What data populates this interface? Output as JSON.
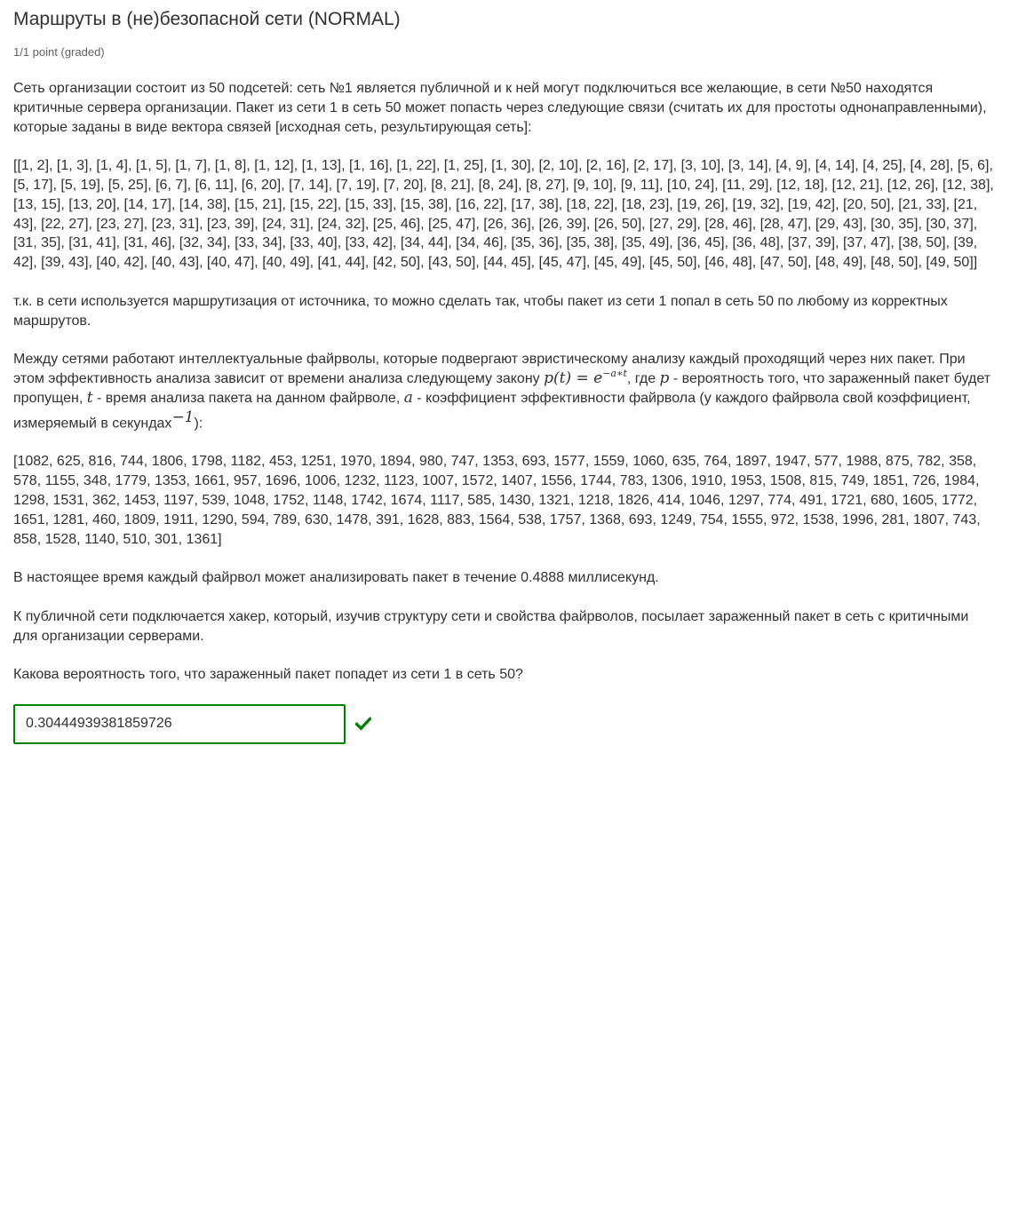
{
  "problem": {
    "title": "Маршруты в (не)безопасной сети (NORMAL)",
    "progress": "1/1 point (graded)",
    "paragraphs": {
      "intro": "Сеть организации состоит из 50 подсетей: сеть №1 является публичной и к ней могут подключиться все желающие, в сети №50 находятся критичные сервера организации. Пакет из сети 1 в сеть 50 может попасть через следующие связи (считать их для простоты однонаправленными), которые заданы в виде вектора связей [исходная сеть, результирующая сеть]:",
      "links": "[[1, 2], [1, 3], [1, 4], [1, 5], [1, 7], [1, 8], [1, 12], [1, 13], [1, 16], [1, 22], [1, 25], [1, 30], [2, 10], [2, 16], [2, 17], [3, 10], [3, 14], [4, 9], [4, 14], [4, 25], [4, 28], [5, 6], [5, 17], [5, 19], [5, 25], [6, 7], [6, 11], [6, 20], [7, 14], [7, 19], [7, 20], [8, 21], [8, 24], [8, 27], [9, 10], [9, 11], [10, 24], [11, 29], [12, 18], [12, 21], [12, 26], [12, 38], [13, 15], [13, 20], [14, 17], [14, 38], [15, 21], [15, 22], [15, 33], [15, 38], [16, 22], [17, 38], [18, 22], [18, 23], [19, 26], [19, 32], [19, 42], [20, 50], [21, 33], [21, 43], [22, 27], [23, 27], [23, 31], [23, 39], [24, 31], [24, 32], [25, 46], [25, 47], [26, 36], [26, 39], [26, 50], [27, 29], [28, 46], [28, 47], [29, 43], [30, 35], [30, 37], [31, 35], [31, 41], [31, 46], [32, 34], [33, 34], [33, 40], [33, 42], [34, 44], [34, 46], [35, 36], [35, 38], [35, 49], [36, 45], [36, 48], [37, 39], [37, 47], [38, 50], [39, 42], [39, 43], [40, 42], [40, 43], [40, 47], [40, 49], [41, 44], [42, 50], [43, 50], [44, 45], [45, 47], [45, 49], [45, 50], [46, 48], [47, 50], [48, 49], [48, 50], [49, 50]]",
      "routing": "т.к. в сети используется маршрутизация от источника, то можно сделать так, чтобы пакет из сети 1 попал в сеть 50 по любому из корректных маршрутов.",
      "firewall_a": "Между сетями работают интеллектуальные файрволы, которые подвергают эвристическому анализу каждый проходящий через них пакет. При этом эффективность анализа зависит от времени анализа следующему закону ",
      "formula_lhs": "p(t) = e",
      "formula_exp": "−a∗t",
      "firewall_b": ", где ",
      "var_p": "p",
      "firewall_c": " - вероятность того, что зараженный пакет будет пропущен, ",
      "var_t": "t",
      "firewall_d": " - время анализа пакета на данном файрволе, ",
      "var_a": "a",
      "firewall_e": " - коэффициент эффективности файрвола (у каждого файрвола свой коэффициент, измеряемый в секундах",
      "unit_exp": "−1",
      "firewall_f": "):",
      "coefficients": "[1082, 625, 816, 744, 1806, 1798, 1182, 453, 1251, 1970, 1894, 980, 747, 1353, 693, 1577, 1559, 1060, 635, 764, 1897, 1947, 577, 1988, 875, 782, 358, 578, 1155, 348, 1779, 1353, 1661, 957, 1696, 1006, 1232, 1123, 1007, 1572, 1407, 1556, 1744, 783, 1306, 1910, 1953, 1508, 815, 749, 1851, 726, 1984, 1298, 1531, 362, 1453, 1197, 539, 1048, 1752, 1148, 1742, 1674, 1117, 585, 1430, 1321, 1218, 1826, 414, 1046, 1297, 774, 491, 1721, 680, 1605, 1772, 1651, 1281, 460, 1809, 1911, 1290, 594, 789, 630, 1478, 391, 1628, 883, 1564, 538, 1757, 1368, 693, 1249, 754, 1555, 972, 1538, 1996, 281, 1807, 743, 858, 1528, 1140, 510, 301, 1361]",
      "analysis_time": "В настоящее время каждый файрвол может анализировать пакет в течение 0.4888 миллисекунд.",
      "hacker": "К публичной сети подключается хакер, который, изучив структуру сети и свойства файрволов, посылает зараженный пакет в сеть с критичными для организации серверами.",
      "question": "Какова вероятность того, что зараженный пакет попадет из сети 1 в сеть 50?"
    },
    "answer": {
      "value": "0.30444939381859726",
      "status_icon": "checkmark-icon",
      "status_color": "#008100"
    }
  }
}
